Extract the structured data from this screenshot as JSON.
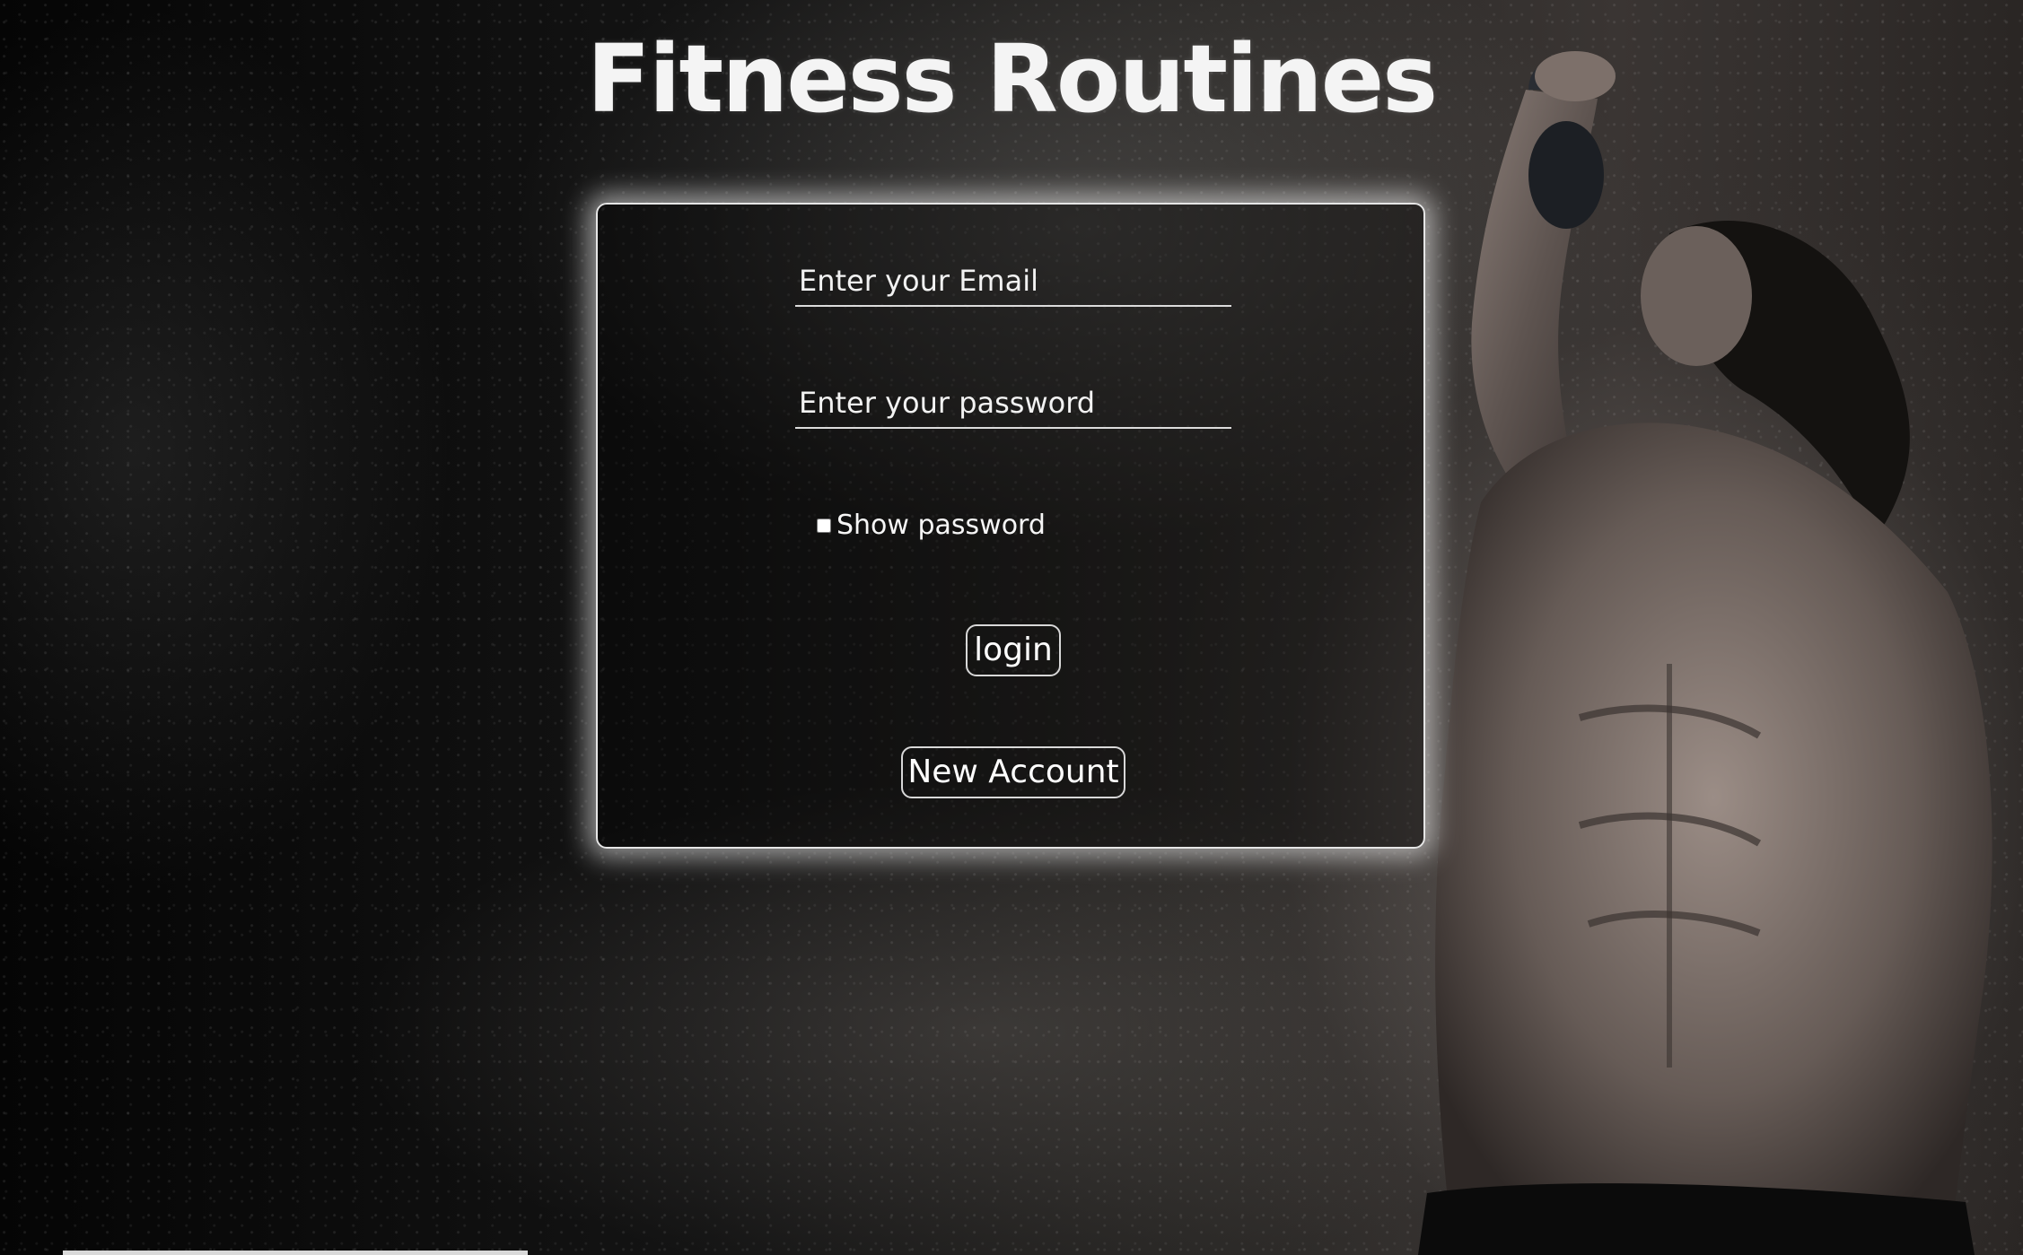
{
  "page": {
    "title": "Fitness Routines"
  },
  "login_form": {
    "email_placeholder": "Enter your Email",
    "password_placeholder": "Enter your password",
    "show_password_label": "Show password",
    "show_password_checked": false,
    "login_button_label": "login",
    "new_account_button_label": "New Account"
  },
  "background": {
    "description_icon": "athlete-with-kettlebell-photo"
  },
  "colors": {
    "text": "#ffffff",
    "card_border": "#e6e6e6",
    "card_glow": "#ffffff",
    "background": "#000000"
  }
}
